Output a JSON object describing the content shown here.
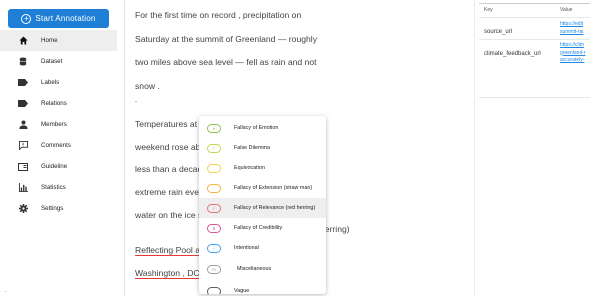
{
  "sidebar": {
    "start_annotation": "Start Annotation",
    "items": [
      {
        "label": "Home",
        "icon": "home-icon"
      },
      {
        "label": "Dataset",
        "icon": "database-icon"
      },
      {
        "label": "Labels",
        "icon": "label-icon"
      },
      {
        "label": "Relations",
        "icon": "label-icon"
      },
      {
        "label": "Members",
        "icon": "person-icon"
      },
      {
        "label": "Comments",
        "icon": "comment-icon"
      },
      {
        "label": "Guideline",
        "icon": "book-icon"
      },
      {
        "label": "Statistics",
        "icon": "bar-chart-icon"
      },
      {
        "label": "Settings",
        "icon": "gear-icon"
      }
    ]
  },
  "document": {
    "lines": [
      "For the first time on record , precipitation on",
      "Saturday at the summit of Greenland — roughly",
      "two miles above sea level — fell as rain and not",
      "snow .",
      "-",
      "Temperatures at",
      "weekend rose ab",
      "less than a decad",
      "extreme rain even",
      "water on the ice s",
      "Reflecting Pool a",
      "Washington , DC"
    ],
    "herring_tail": "herring)",
    "bottom_mark": "."
  },
  "metadata": {
    "headers": {
      "key": "Key",
      "value": "Value"
    },
    "rows": [
      {
        "key": "source_url",
        "value_lines": [
          "https://edit",
          "summit-rai"
        ]
      },
      {
        "key": "climate_feedback_url",
        "value_lines": [
          "https://clim",
          "greenland-r",
          "accurately-"
        ]
      }
    ]
  },
  "dropdown": {
    "options": [
      {
        "label": "Fallacy of Emotion",
        "badge": "e",
        "color": "#8bc34a"
      },
      {
        "label": "False Dilemma",
        "badge": "f",
        "color": "#c6d64a"
      },
      {
        "label": "Equivocation",
        "badge": "",
        "color": "#f5cf52"
      },
      {
        "label": "Fallacy of Extension (straw man)",
        "badge": "",
        "color": "#f2b33f"
      },
      {
        "label": "Fallacy of Relevance (red herring)",
        "badge": "r",
        "color": "#e57373"
      },
      {
        "label": "Fallacy of Credibility",
        "badge": "b",
        "color": "#e0529a"
      },
      {
        "label": "Intentional",
        "badge": "i",
        "color": "#42a5f5"
      },
      {
        "label": "Miscellaneous",
        "badge": "m",
        "color": "#9e9e9e"
      },
      {
        "label": "Vague",
        "badge": "",
        "color": "#616161"
      }
    ],
    "selected_index": 4
  }
}
